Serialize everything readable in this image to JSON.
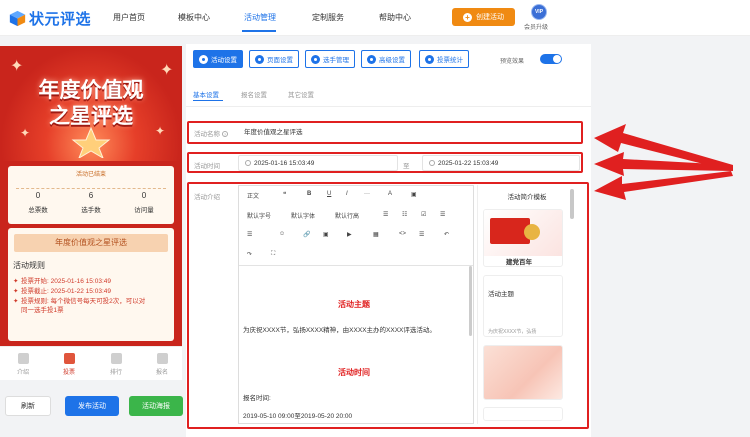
{
  "app": {
    "logo_text": "状元评选"
  },
  "nav": {
    "items": [
      "用户首页",
      "模板中心",
      "活动管理",
      "定制服务",
      "帮助中心"
    ],
    "active_index": 2
  },
  "header": {
    "create_label": "创建活动",
    "vip_badge": "VIP",
    "vip_label": "会员升级"
  },
  "preview": {
    "banner_title_1": "年度价值观",
    "banner_title_2": "之星评选",
    "status": "活动已结束",
    "stats": [
      {
        "value": "0",
        "label": "总票数"
      },
      {
        "value": "6",
        "label": "选手数"
      },
      {
        "value": "0",
        "label": "访问量"
      }
    ],
    "rules_title": "年度价值观之星评选",
    "rules_heading": "活动规则",
    "rules": [
      {
        "key": "投票开始:",
        "value": "2025-01-16 15:03:49"
      },
      {
        "key": "投票截止:",
        "value": "2025-01-22 15:03:49"
      },
      {
        "key": "投票规则:",
        "value": "每个微信号每天可投2次，可以对"
      },
      {
        "key": "",
        "value": "同一选手投1票"
      }
    ],
    "tabbar": [
      "介绍",
      "投票",
      "排行",
      "报名"
    ],
    "tabbar_active": 1
  },
  "actions": {
    "refresh": "刷新",
    "publish": "发布活动",
    "poster": "活动海报"
  },
  "toolbar": {
    "tools": [
      "活动设置",
      "页面设置",
      "选手管理",
      "高级设置",
      "投票统计"
    ],
    "preview_label": "预览效果",
    "preview_on": true
  },
  "subtabs": [
    "基本设置",
    "报名设置",
    "其它设置"
  ],
  "form": {
    "name_label": "活动名称",
    "name_value": "年度价值观之星评选",
    "time_label": "活动时间",
    "start_time": "2025-01-16 15:03:49",
    "to_label": "至",
    "end_time": "2025-01-22 15:03:49",
    "intro_label": "活动介绍"
  },
  "editor": {
    "toolbar_row1": [
      "正文",
      "❝",
      "B",
      "U",
      "I",
      "···",
      "A",
      "▣"
    ],
    "toolbar_row2": [
      "默认字号",
      "默认字体",
      "默认行高",
      "☰",
      "☷",
      "☑",
      "☰"
    ],
    "toolbar_row3": [
      "☰",
      "☺",
      "🔗",
      "▣",
      "▶",
      "▦",
      "<>",
      "☰",
      "↶"
    ],
    "toolbar_row4": [
      "↷",
      "⛶"
    ],
    "section1_title": "活动主题",
    "section1_text": "为庆祝XXXX节，弘扬XXXX精神，由XXXX主办的XXXX评选活动。",
    "section2_title": "活动时间",
    "section2_line1": "报名时间:",
    "section2_line2": "2019-05-10 09:00至2019-05-20 20:00"
  },
  "templates": {
    "heading": "活动简介模板",
    "card1_title": "建党百年",
    "card2_title": "活动主题",
    "card2_text": "为庆祝XXXX节，弘扬"
  },
  "colors": {
    "primary": "#1e73e8",
    "orange": "#f08a12",
    "green": "#3bb54a",
    "highlight": "#e02020",
    "banner": "#c9251c"
  }
}
